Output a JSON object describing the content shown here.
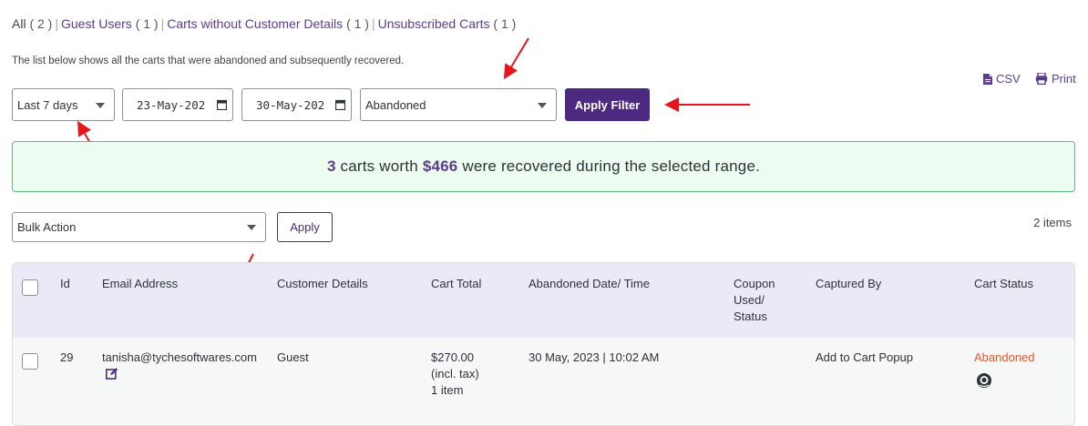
{
  "filters_nav": {
    "all": {
      "label": "All",
      "count": "( 2 )"
    },
    "guest": {
      "label": "Guest Users",
      "count": "( 1 )"
    },
    "no_details": {
      "label": "Carts without Customer Details",
      "count": "( 1 )"
    },
    "unsubscribed": {
      "label": "Unsubscribed Carts",
      "count": "( 1 )"
    },
    "separator": "|"
  },
  "description": "The list below shows all the carts that were abandoned and subsequently recovered.",
  "export": {
    "csv_label": "CSV",
    "print_label": "Print"
  },
  "filter": {
    "range": "Last 7 days",
    "start_date": "23-May-202",
    "end_date": "30-May-202",
    "status": "Abandoned",
    "apply_label": "Apply Filter"
  },
  "summary": {
    "count": "3",
    "pre": "carts worth",
    "amount": "$466",
    "post": "were recovered during the selected range."
  },
  "bulk": {
    "action": "Bulk Action",
    "apply_label": "Apply"
  },
  "items_count": "2 items",
  "table": {
    "headers": {
      "id": "Id",
      "email": "Email Address",
      "customer": "Customer Details",
      "total": "Cart Total",
      "date": "Abandoned Date/ Time",
      "coupon_1": "Coupon",
      "coupon_2": "Used/",
      "coupon_3": "Status",
      "captured": "Captured By",
      "status": "Cart Status"
    },
    "rows": [
      {
        "id": "29",
        "email": "tanisha@tychesoftwares.com",
        "customer": "Guest",
        "total": "$270.00",
        "tax": "(incl. tax)",
        "items": "1 item",
        "date": "30 May, 2023 | 10:02 AM",
        "captured": "Add to Cart Popup",
        "status": "Abandoned"
      }
    ]
  },
  "colors": {
    "accent": "#4b2a7f",
    "link": "#5b3d8c",
    "success_bg": "#edfcf1",
    "abandoned": "#e2592c",
    "arrow": "#e8141c"
  }
}
